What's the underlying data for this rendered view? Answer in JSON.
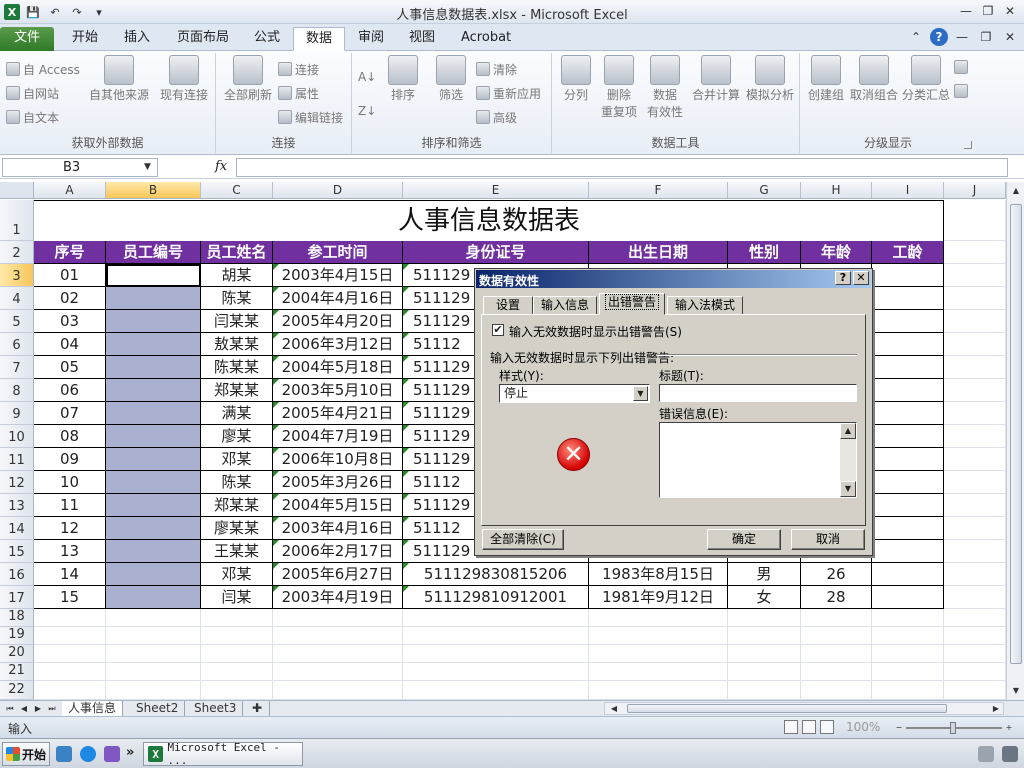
{
  "window": {
    "title": "人事信息数据表.xlsx - Microsoft Excel",
    "controls": {
      "minimize": "—",
      "restore": "❐",
      "close": "✕"
    }
  },
  "qat": {
    "logo": "X",
    "save": "💾",
    "undo": "↶",
    "redo": "↷",
    "customize": "▾"
  },
  "tabs": [
    {
      "label": "文件"
    },
    {
      "label": "开始"
    },
    {
      "label": "插入"
    },
    {
      "label": "页面布局"
    },
    {
      "label": "公式"
    },
    {
      "label": "数据"
    },
    {
      "label": "审阅"
    },
    {
      "label": "视图"
    },
    {
      "label": "Acrobat"
    }
  ],
  "ribbon": {
    "get_external": {
      "label": "获取外部数据",
      "access": "自 Access",
      "web": "自网站",
      "text": "自文本",
      "other": "自其他来源",
      "existing": "现有连接"
    },
    "connections": {
      "label": "连接",
      "refresh_all": "全部刷新",
      "connections": "连接",
      "properties": "属性",
      "edit_links": "编辑链接"
    },
    "sort_filter": {
      "label": "排序和筛选",
      "sort": "排序",
      "filter": "筛选",
      "clear": "清除",
      "reapply": "重新应用",
      "advanced": "高级"
    },
    "data_tools": {
      "label": "数据工具",
      "text_to_columns": "分列",
      "remove_dup_1": "删除",
      "remove_dup_2": "重复项",
      "validation_1": "数据",
      "validation_2": "有效性",
      "consolidate": "合并计算",
      "whatif": "模拟分析"
    },
    "outline": {
      "label": "分级显示",
      "group": "创建组",
      "ungroup": "取消组合",
      "subtotal": "分类汇总"
    }
  },
  "formula_bar": {
    "name_box": "B3",
    "fx": "fx",
    "content": ""
  },
  "sheet": {
    "columns": [
      "A",
      "B",
      "C",
      "D",
      "E",
      "F",
      "G",
      "H",
      "I",
      "J"
    ],
    "rows": [
      "1",
      "2",
      "3",
      "4",
      "5",
      "6",
      "7",
      "8",
      "9",
      "10",
      "11",
      "12",
      "13",
      "14",
      "15",
      "16",
      "17",
      "18",
      "19",
      "20",
      "21",
      "22"
    ],
    "title": "人事信息数据表",
    "headers": [
      "序号",
      "员工编号",
      "员工姓名",
      "参工时间",
      "身份证号",
      "出生日期",
      "性别",
      "年龄",
      "工龄"
    ],
    "records": [
      {
        "no": "01",
        "name": "胡某",
        "date": "2003年4月15日",
        "id": "511129"
      },
      {
        "no": "02",
        "name": "陈某",
        "date": "2004年4月16日",
        "id": "511129"
      },
      {
        "no": "03",
        "name": "闫某某",
        "date": "2005年4月20日",
        "id": "511129"
      },
      {
        "no": "04",
        "name": "敖某某",
        "date": "2006年3月12日",
        "id": "51112"
      },
      {
        "no": "05",
        "name": "陈某某",
        "date": "2004年5月18日",
        "id": "511129"
      },
      {
        "no": "06",
        "name": "郑某某",
        "date": "2003年5月10日",
        "id": "511129"
      },
      {
        "no": "07",
        "name": "满某",
        "date": "2005年4月21日",
        "id": "511129"
      },
      {
        "no": "08",
        "name": "廖某",
        "date": "2004年7月19日",
        "id": "511129"
      },
      {
        "no": "09",
        "name": "邓某",
        "date": "2006年10月8日",
        "id": "511129"
      },
      {
        "no": "10",
        "name": "陈某",
        "date": "2005年3月26日",
        "id": "51112"
      },
      {
        "no": "11",
        "name": "郑某某",
        "date": "2004年5月15日",
        "id": "511129"
      },
      {
        "no": "12",
        "name": "廖某某",
        "date": "2003年4月16日",
        "id": "51112"
      },
      {
        "no": "13",
        "name": "王某某",
        "date": "2006年2月17日",
        "id": "511129"
      },
      {
        "no": "14",
        "name": "邓某",
        "date": "2005年6月27日",
        "id": "511129830815206",
        "birth": "1983年8月15日",
        "gender": "男",
        "age": "26"
      },
      {
        "no": "15",
        "name": "闫某",
        "date": "2003年4月19日",
        "id": "511129810912001",
        "birth": "1981年9月12日",
        "gender": "女",
        "age": "28"
      }
    ]
  },
  "sheet_tabs": {
    "nav": [
      "⏮",
      "◀",
      "▶",
      "⏭"
    ],
    "tabs": [
      "人事信息",
      "Sheet2",
      "Sheet3"
    ],
    "new_tab_icon": "new-sheet-icon"
  },
  "status": {
    "mode": "输入",
    "zoom": "100%"
  },
  "taskbar": {
    "start": "开始",
    "more": "»",
    "excel_task": "Microsoft Excel - ..."
  },
  "dialog": {
    "title": "数据有效性",
    "help": "?",
    "close": "✕",
    "tabs": [
      "设置",
      "输入信息",
      "出错警告",
      "输入法模式"
    ],
    "checkbox_label": "输入无效数据时显示出错警告(S)",
    "checkbox_checked": "✔",
    "section_label": "输入无效数据时显示下列出错警告:",
    "style_label": "样式(Y):",
    "style_value": "停止",
    "title_label": "标题(T):",
    "title_value": "",
    "error_label": "错误信息(E):",
    "error_value": "",
    "stop_icon": "✕",
    "clear_all": "全部清除(C)",
    "ok": "确定",
    "cancel": "取消"
  }
}
